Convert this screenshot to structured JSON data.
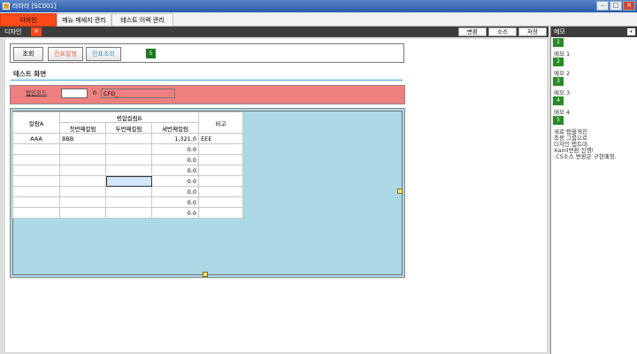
{
  "window": {
    "title": "라라라 [SC001]"
  },
  "menu": {
    "tabs": [
      "디자인",
      "메뉴 메세지 관리",
      "테스트 이력 관리"
    ]
  },
  "subbar": {
    "label": "디자인",
    "pin": "※",
    "buttons": [
      "변환",
      "소스",
      "저장"
    ]
  },
  "memo": {
    "title": "메모",
    "items": [
      {
        "num": "1",
        "text": "메모 1"
      },
      {
        "num": "2",
        "text": "메모 2"
      },
      {
        "num": "3",
        "text": "메모 3"
      },
      {
        "num": "4",
        "text": "메모 4"
      }
    ],
    "last_num": "5",
    "last_lines": [
      "새로 탭을게진",
      "조용 그룹으로",
      "디자인 탭트대",
      "Xaml변환 진행!",
      ".CS소스 변환은 구현예정."
    ]
  },
  "form": {
    "buttons": [
      "조회",
      "전표발행",
      "전표조회"
    ],
    "badge": "5",
    "screen_title": "테스트 화면",
    "field_label": "법인코드",
    "field_value": "",
    "field_num": "0",
    "field_code": "CFD_"
  },
  "grid": {
    "header_top": {
      "col_a": "컬럼A",
      "merged": "병합컬럼B",
      "note": "비고"
    },
    "header_sub": [
      "첫번째컬럼",
      "두번째컬럼",
      "세번째컬럼"
    ],
    "rows": [
      [
        "AAA",
        "BBB",
        "",
        "1,321.0",
        "EEE"
      ],
      [
        "",
        "",
        "",
        "0.0",
        ""
      ],
      [
        "",
        "",
        "",
        "0.0",
        ""
      ],
      [
        "",
        "",
        "",
        "0.0",
        ""
      ],
      [
        "",
        "",
        "",
        "0.0",
        ""
      ],
      [
        "",
        "",
        "",
        "0.0",
        ""
      ],
      [
        "",
        "",
        "",
        "0.0",
        ""
      ],
      [
        "",
        "",
        "",
        "0.0",
        ""
      ]
    ]
  }
}
